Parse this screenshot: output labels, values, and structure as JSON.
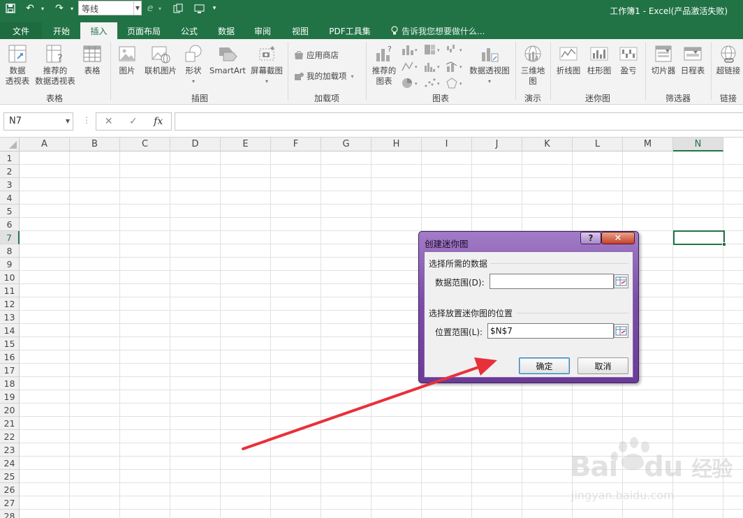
{
  "titlebar": {
    "font_name": "等线",
    "window_title": "工作簿1 - Excel(产品激活失败)"
  },
  "tabs": {
    "file": "文件",
    "home": "开始",
    "insert": "插入",
    "page_layout": "页面布局",
    "formulas": "公式",
    "data": "数据",
    "review": "审阅",
    "view": "视图",
    "pdf": "PDF工具集",
    "tell_me": "告诉我您想要做什么..."
  },
  "ribbon": {
    "tables": {
      "group": "表格",
      "pivot_line1": "数据",
      "pivot_line2": "透视表",
      "recommended_pivot_line1": "推荐的",
      "recommended_pivot_line2": "数据透视表",
      "table": "表格"
    },
    "illustrations": {
      "group": "插图",
      "pictures": "图片",
      "online_pictures": "联机图片",
      "shapes": "形状",
      "smartart": "SmartArt",
      "screenshot": "屏幕截图"
    },
    "addins": {
      "group": "加载项",
      "store": "应用商店",
      "my_addins": "我的加载项"
    },
    "charts": {
      "group": "图表",
      "recommended_line1": "推荐的",
      "recommended_line2": "图表",
      "pivot_chart": "数据透视图"
    },
    "tours": {
      "group": "演示",
      "map_line1": "三维地",
      "map_line2": "图"
    },
    "sparklines": {
      "group": "迷你图",
      "line": "折线图",
      "column": "柱形图",
      "winloss": "盈亏"
    },
    "filters": {
      "group": "筛选器",
      "slicer": "切片器",
      "timeline": "日程表"
    },
    "links": {
      "group": "链接",
      "hyperlink": "超链接"
    }
  },
  "formula_bar": {
    "name_box": "N7",
    "fx": "fx",
    "value": ""
  },
  "sheet": {
    "columns": [
      "A",
      "B",
      "C",
      "D",
      "E",
      "F",
      "G",
      "H",
      "I",
      "J",
      "K",
      "L",
      "M",
      "N"
    ],
    "rows": [
      "1",
      "2",
      "3",
      "4",
      "5",
      "6",
      "7",
      "8",
      "9",
      "10",
      "11",
      "12",
      "13",
      "14",
      "15",
      "16",
      "17",
      "18",
      "19",
      "20",
      "21",
      "22",
      "23",
      "24",
      "25",
      "26",
      "27",
      "28"
    ],
    "active_column": "N",
    "active_row": "7"
  },
  "dialog": {
    "title": "创建迷你图",
    "help": "?",
    "close": "✕",
    "section_data": "选择所需的数据",
    "data_range_label": "数据范围(D):",
    "data_range_value": "",
    "section_location": "选择放置迷你图的位置",
    "location_range_label": "位置范围(L):",
    "location_range_value": "$N$7",
    "ok": "确定",
    "cancel": "取消"
  },
  "colors": {
    "excel_green": "#217346",
    "annotation_arrow": "#e8303a",
    "dialog_purple": "#7c4ea9"
  },
  "watermark": {
    "brand": "Bai",
    "brand2": "du",
    "brand_cn": "经验",
    "url": "jingyan.baidu.com"
  }
}
